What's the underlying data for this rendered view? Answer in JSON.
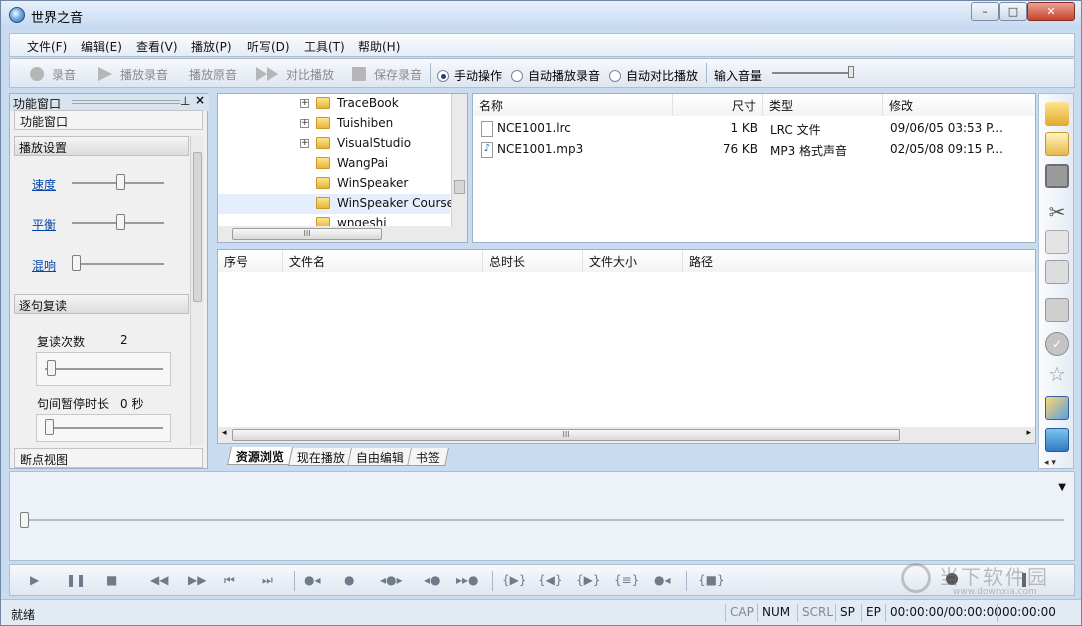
{
  "window": {
    "title": "世界之音",
    "controls": [
      "–",
      "□",
      "✕"
    ]
  },
  "menu": [
    "文件(F)",
    "编辑(E)",
    "查看(V)",
    "播放(P)",
    "听写(D)",
    "工具(T)",
    "帮助(H)"
  ],
  "toolbar": {
    "buttons": [
      "录音",
      "播放录音",
      "播放原音",
      "对比播放",
      "保存录音"
    ],
    "radios": [
      {
        "label": "手动操作",
        "checked": true
      },
      {
        "label": "自动播放录音",
        "checked": false
      },
      {
        "label": "自动对比播放",
        "checked": false
      }
    ],
    "volume_label": "输入音量",
    "volume_level": 0.97
  },
  "left_panel": {
    "header": "功能窗口",
    "header_pin": "⊥",
    "header_close": "×",
    "title": "功能窗口",
    "section_play": "播放设置",
    "speed_label": "速度",
    "balance_label": "平衡",
    "reverb_label": "混响",
    "speed_level": 0.5,
    "balance_level": 0.5,
    "reverb_level": 0.0,
    "section_repeat": "逐句复读",
    "repeat_count_label": "复读次数",
    "repeat_count_value": "2",
    "pause_label": "句间暂停时长",
    "pause_value": "0 秒",
    "breakpoint_label": "断点视图"
  },
  "tree": {
    "items": [
      {
        "name": "TraceBook",
        "expandable": true
      },
      {
        "name": "Tuishiben",
        "expandable": true
      },
      {
        "name": "VisualStudio",
        "expandable": true
      },
      {
        "name": "WangPai",
        "expandable": false
      },
      {
        "name": "WinSpeaker",
        "expandable": false
      },
      {
        "name": "WinSpeaker Course",
        "expandable": false,
        "selected": true
      },
      {
        "name": "wngeshi",
        "expandable": false
      }
    ],
    "scroll_mark": "III"
  },
  "file_list": {
    "columns": [
      "名称",
      "尺寸",
      "类型",
      "修改"
    ],
    "rows": [
      {
        "name": "NCE1001.lrc",
        "size": "1 KB",
        "type": "LRC 文件",
        "modified": "09/06/05 03:53 P..."
      },
      {
        "name": "NCE1001.mp3",
        "size": "76 KB",
        "type": "MP3 格式声音",
        "modified": "02/05/08 09:15 P..."
      }
    ]
  },
  "playlist": {
    "columns": [
      "序号",
      "文件名",
      "总时长",
      "文件大小",
      "路径"
    ],
    "scroll_mark": "III"
  },
  "tabs": [
    "资源浏览",
    "现在播放",
    "自由编辑",
    "书签"
  ],
  "statusbar": {
    "left": "就绪",
    "indicators": [
      "CAP",
      "NUM",
      "SCRL",
      "SP",
      "EP"
    ],
    "time1": "00:00:00/00:00:00",
    "time2": "00:00:00"
  },
  "watermark": {
    "text": "当下软件园",
    "url": "www.downxia.com"
  },
  "colors": {
    "accent": "#1f3f7f",
    "frame": "#c9dbef",
    "folder": "#e9b43a"
  }
}
